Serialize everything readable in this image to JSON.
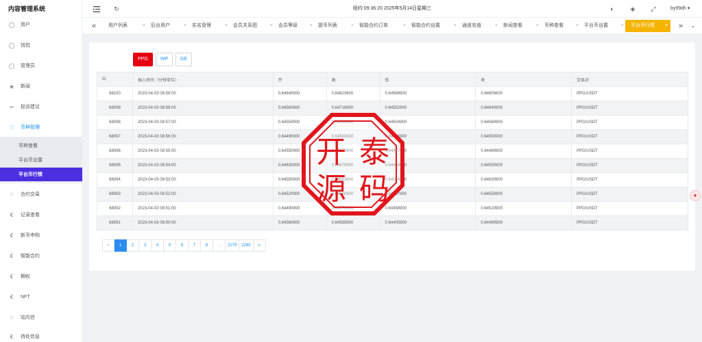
{
  "app": {
    "title": "内容管理系统"
  },
  "sidebar": {
    "items": [
      {
        "label": "用户",
        "icon": "user-icon"
      },
      {
        "label": "钱包",
        "icon": "wallet-icon"
      },
      {
        "label": "管理员",
        "icon": "shield-icon"
      },
      {
        "label": "新闻",
        "icon": "tag-icon"
      },
      {
        "label": "投诉建议",
        "icon": "eye-icon"
      },
      {
        "label": "币种管理",
        "icon": "coin-icon"
      },
      {
        "label": "合约交易",
        "icon": "diamond-icon"
      },
      {
        "label": "记录查看",
        "icon": "currency-icon"
      },
      {
        "label": "新币申购",
        "icon": "currency-icon"
      },
      {
        "label": "智能合约",
        "icon": "currency-icon"
      },
      {
        "label": "期权",
        "icon": "currency-icon"
      },
      {
        "label": "NFT",
        "icon": "currency-icon"
      },
      {
        "label": "站内信",
        "icon": "bell-icon"
      },
      {
        "label": "待处信息",
        "icon": "currency-icon"
      }
    ],
    "submenu": [
      {
        "label": "币种查看"
      },
      {
        "label": "平台币设置"
      },
      {
        "label": "平台币行情"
      }
    ]
  },
  "topbar": {
    "clock": "纽约:09:36:20 2025年5月14日星期三",
    "user": "by99dh"
  },
  "tabs": [
    {
      "label": "用户列表"
    },
    {
      "label": "后台用户"
    },
    {
      "label": "实名管理"
    },
    {
      "label": "会员关系图"
    },
    {
      "label": "会员等级"
    },
    {
      "label": "提币列表"
    },
    {
      "label": "智能合约订单"
    },
    {
      "label": "智能合约设置"
    },
    {
      "label": "通道充值"
    },
    {
      "label": "新闻查看"
    },
    {
      "label": "币种查看"
    },
    {
      "label": "平台币设置"
    },
    {
      "label": "平台币行情"
    }
  ],
  "symbols": [
    {
      "label": "PPG"
    },
    {
      "label": "WP"
    },
    {
      "label": "GE"
    }
  ],
  "table": {
    "headers": [
      "ID",
      "插入时间（分钟单位）",
      "开",
      "高",
      "低",
      "收",
      "交易对"
    ],
    "rows": [
      [
        "68100",
        "2023-04-03 08:59:00",
        "0.64640900",
        "0.64823600",
        "0.64568900",
        "0.64805600",
        "PPG/USDT"
      ],
      [
        "68099",
        "2023-04-03 08:58:00",
        "0.64560900",
        "0.64716900",
        "0.64552900",
        "0.64640900",
        "PPG/USDT"
      ],
      [
        "68098",
        "2023-04-03 08:57:00",
        "0.64550900",
        "0.64560900",
        "0.64504900",
        "0.64560900",
        "PPG/USDT"
      ],
      [
        "68097",
        "2023-04-03 08:56:00",
        "0.64490900",
        "0.64563900",
        "0.64405900",
        "0.64550900",
        "PPG/USDT"
      ],
      [
        "68096",
        "2023-04-03 08:55:00",
        "0.64550900",
        "0.64570900",
        "0.64477900",
        "0.64490900",
        "PPG/USDT"
      ],
      [
        "68095",
        "2023-04-03 08:54:00",
        "0.64630900",
        "0.64670900",
        "0.64453900",
        "0.64550900",
        "PPG/USDT"
      ],
      [
        "68094",
        "2023-04-03 08:53:00",
        "0.64550900",
        "0.64653900",
        "0.64534900",
        "0.64630900",
        "PPG/USDT"
      ],
      [
        "68093",
        "2023-04-03 08:52:00",
        "0.64520900",
        "0.64560900",
        "0.64437900",
        "0.64550900",
        "PPG/USDT"
      ],
      [
        "68092",
        "2023-04-03 08:51:00",
        "0.64490900",
        "0.64570900",
        "0.64458900",
        "0.64520900",
        "PPG/USDT"
      ],
      [
        "68091",
        "2023-04-03 08:50:00",
        "0.64560900",
        "0.64585900",
        "0.64405900",
        "0.64490900",
        "PPG/USDT"
      ]
    ]
  },
  "pagination": [
    "«",
    "1",
    "2",
    "3",
    "4",
    "5",
    "6",
    "7",
    "8",
    "...",
    "2279",
    "2280",
    "»"
  ],
  "watermark": {
    "text": "开泰源码"
  },
  "colors": {
    "accent": "#4b2fe0",
    "active_tab": "#f5b400",
    "symbol_active": "#e60012",
    "stamp": "#e0161c"
  }
}
